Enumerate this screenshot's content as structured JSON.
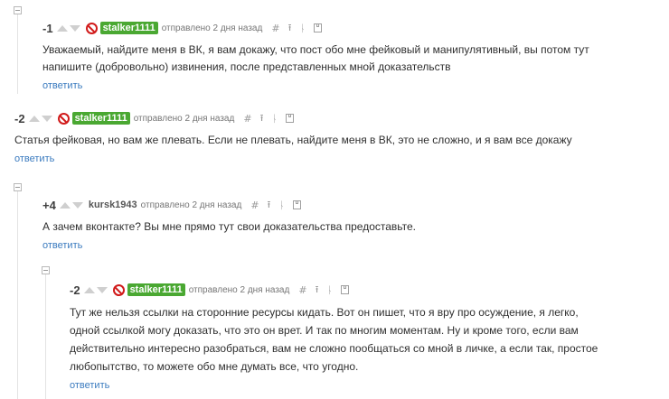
{
  "comments": [
    {
      "score": "-1",
      "author": "stalker1111",
      "time": "отправлено 2 дня назад",
      "banned": true,
      "lines": [
        "Уважаемый, найдите меня в ВК, я вам докажу, что пост обо мне фейковый и манипулятивный, вы потом тут",
        "напишите (добровольно) извинения, после представленных мной доказательств"
      ],
      "reply_label": "ответить"
    },
    {
      "score": "-2",
      "author": "stalker1111",
      "time": "отправлено 2 дня назад",
      "banned": true,
      "lines": [
        "Статья фейковая, но вам же плевать. Если не плевать, найдите меня в ВК, это не сложно, и я вам все докажу"
      ],
      "reply_label": "ответить"
    },
    {
      "score": "+4",
      "author": "kursk1943",
      "time": "отправлено 2 дня назад",
      "banned": false,
      "lines": [
        "А зачем вконтакте? Вы мне прямо тут свои доказательства предоставьте."
      ],
      "reply_label": "ответить"
    },
    {
      "score": "-2",
      "author": "stalker1111",
      "time": "отправлено 2 дня назад",
      "banned": true,
      "lines": [
        "Тут же нельзя ссылки на сторонние ресурсы кидать. Вот он пишет, что я вру про осуждение, я легко,",
        "одной ссылкой могу доказать, что это он врет. И так по многим моментам. Ну и кроме того, если вам",
        "действительно интересно разобраться, вам не сложно пообщаться со мной в личке, а если так, простое",
        "любопытство, то можете обо мне думать все, что угодно."
      ],
      "reply_label": "ответить"
    }
  ],
  "icons": {
    "permalink": "#",
    "parent": "⭱",
    "tree": "ᚿ"
  }
}
